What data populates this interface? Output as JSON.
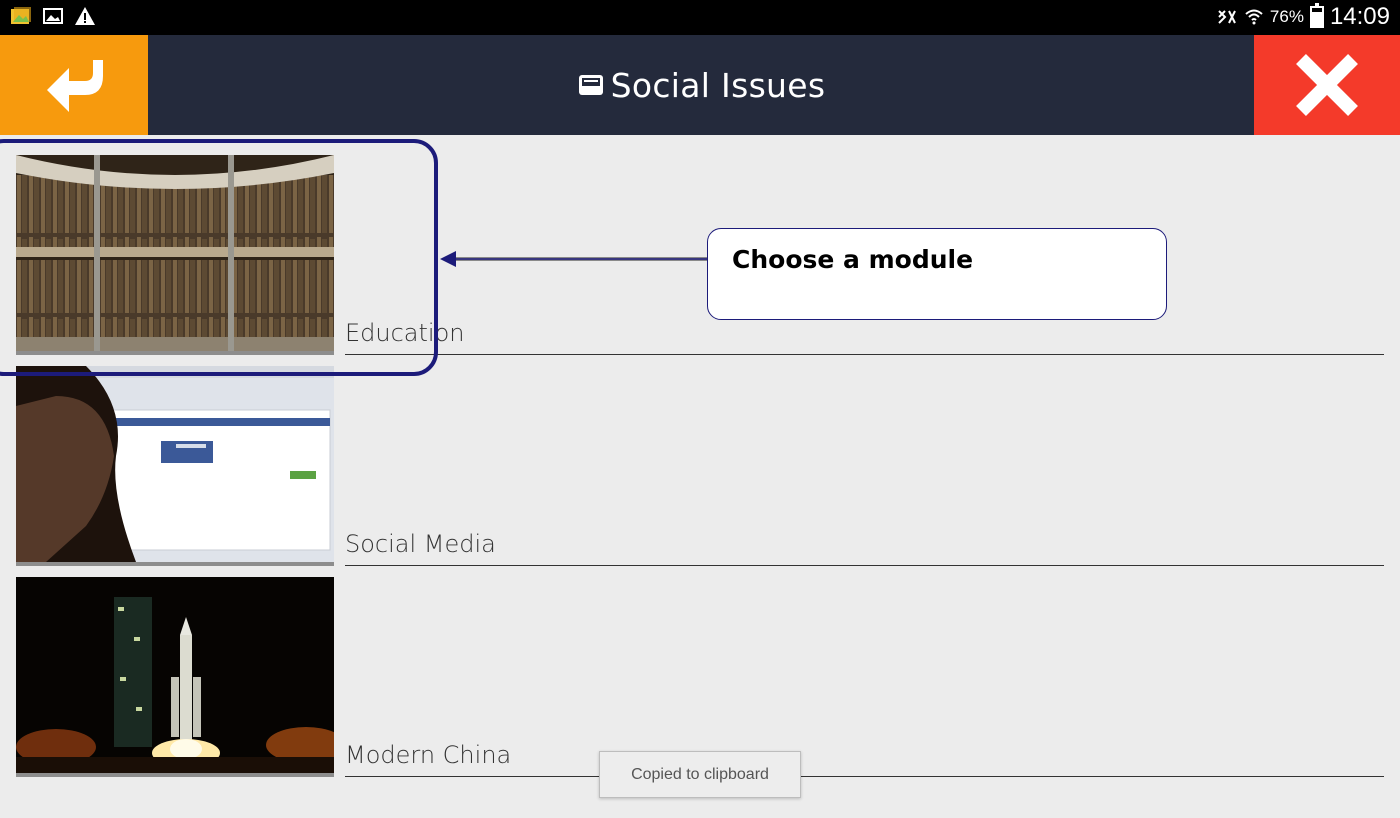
{
  "status_bar": {
    "left_icons": [
      "gallery-icon",
      "image-icon",
      "warning-icon"
    ],
    "right_icons": [
      "mute-icon",
      "wifi-icon",
      "battery-icon"
    ],
    "battery_percent": "76%",
    "battery_level": 0.76,
    "time": "14:09"
  },
  "header": {
    "title": "Social Issues",
    "title_icon": "inbox-icon",
    "back_icon": "back-arrow-icon",
    "close_icon": "close-icon",
    "colors": {
      "bar": "#242a3c",
      "back": "#f79a0d",
      "close": "#f43a2a"
    }
  },
  "modules": [
    {
      "label": "Education",
      "thumbnail": "library-bookshelves"
    },
    {
      "label": "Social Media",
      "thumbnail": "person-viewing-facebook"
    },
    {
      "label": "Modern China",
      "thumbnail": "rocket-launch-night"
    }
  ],
  "tutorial": {
    "callout_text": "Choose a module",
    "accent_color": "#1c1b7a"
  },
  "toast": {
    "text": "Copied to clipboard"
  }
}
